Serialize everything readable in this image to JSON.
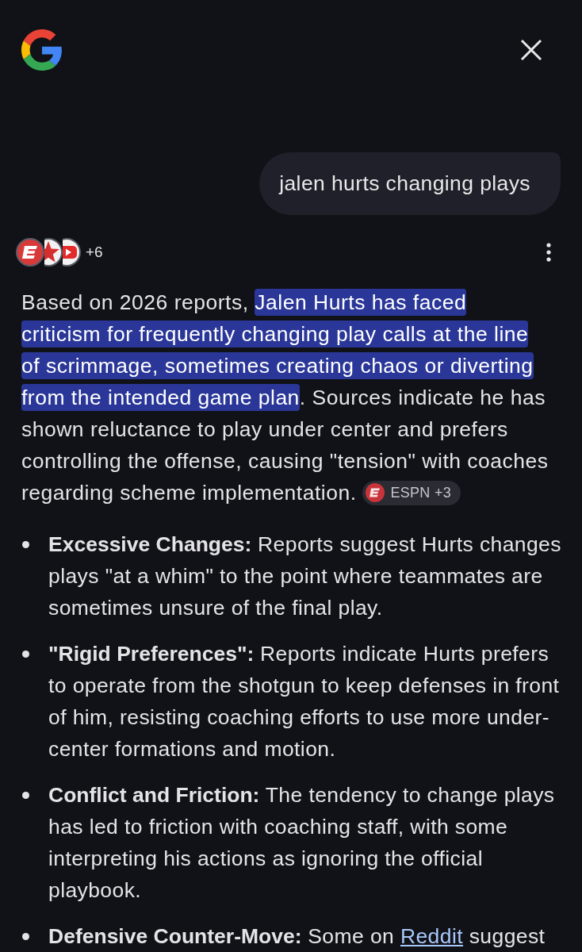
{
  "query": "jalen hurts changing plays",
  "sources": {
    "more_count": "+6"
  },
  "answer": {
    "segments": [
      {
        "text": "Based on 2026 reports, ",
        "highlighted": false
      },
      {
        "text": "Jalen Hurts has faced criticism for frequently changing play calls at the line of scrimmage, sometimes creating chaos or diverting from the intended game plan",
        "highlighted": true
      },
      {
        "text": ". Sources indicate he has shown reluctance to play under center and prefers controlling the offense, causing \"tension\" with coaches regarding scheme implementation.",
        "highlighted": false
      }
    ],
    "source_chip": "ESPN +3"
  },
  "bullets": [
    {
      "label": "Excessive Changes:",
      "parts": [
        {
          "kind": "text",
          "text": "Reports suggest Hurts changes plays \"at a whim\" to the point where teammates are sometimes unsure of the final play."
        }
      ]
    },
    {
      "label": "\"Rigid Preferences\":",
      "parts": [
        {
          "kind": "text",
          "text": "Reports indicate Hurts prefers to operate from the shotgun to keep defenses in front of him, resisting coaching efforts to use more under-center formations and motion."
        }
      ]
    },
    {
      "label": "Conflict and Friction:",
      "parts": [
        {
          "kind": "text",
          "text": "The tendency to change plays has led to friction with coaching staff, with some interpreting his actions as ignoring the official playbook."
        }
      ]
    },
    {
      "label": "Defensive Counter-Move:",
      "parts": [
        {
          "kind": "text",
          "text": "Some on "
        },
        {
          "kind": "link",
          "text": "Reddit"
        },
        {
          "kind": "text",
          "text": " suggest"
        }
      ]
    }
  ]
}
